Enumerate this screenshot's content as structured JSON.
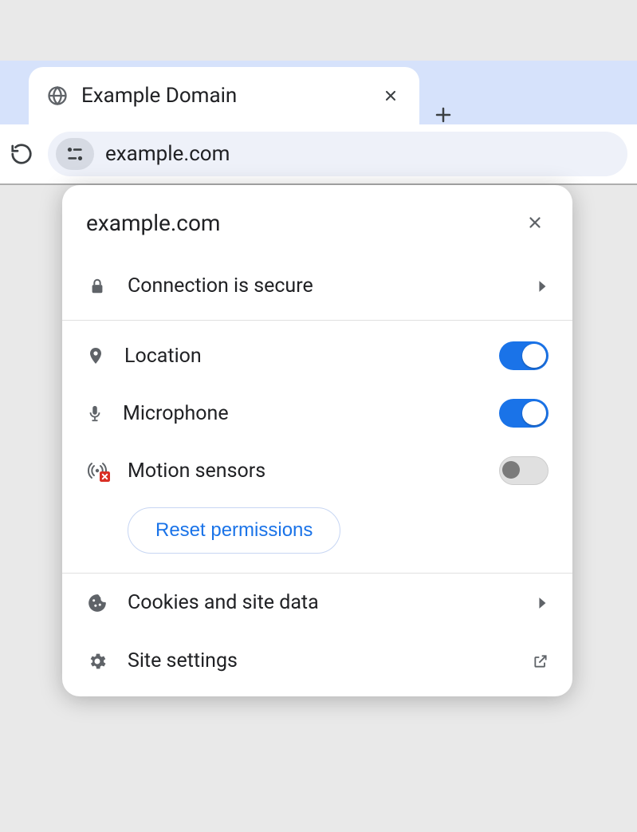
{
  "tab": {
    "title": "Example Domain"
  },
  "address_bar": {
    "url": "example.com"
  },
  "popup": {
    "site": "example.com",
    "connection_label": "Connection is secure",
    "permissions": {
      "location": {
        "label": "Location",
        "enabled": true
      },
      "microphone": {
        "label": "Microphone",
        "enabled": true
      },
      "motion_sensors": {
        "label": "Motion sensors",
        "enabled": false
      }
    },
    "reset_label": "Reset permissions",
    "cookies_label": "Cookies and site data",
    "site_settings_label": "Site settings"
  }
}
